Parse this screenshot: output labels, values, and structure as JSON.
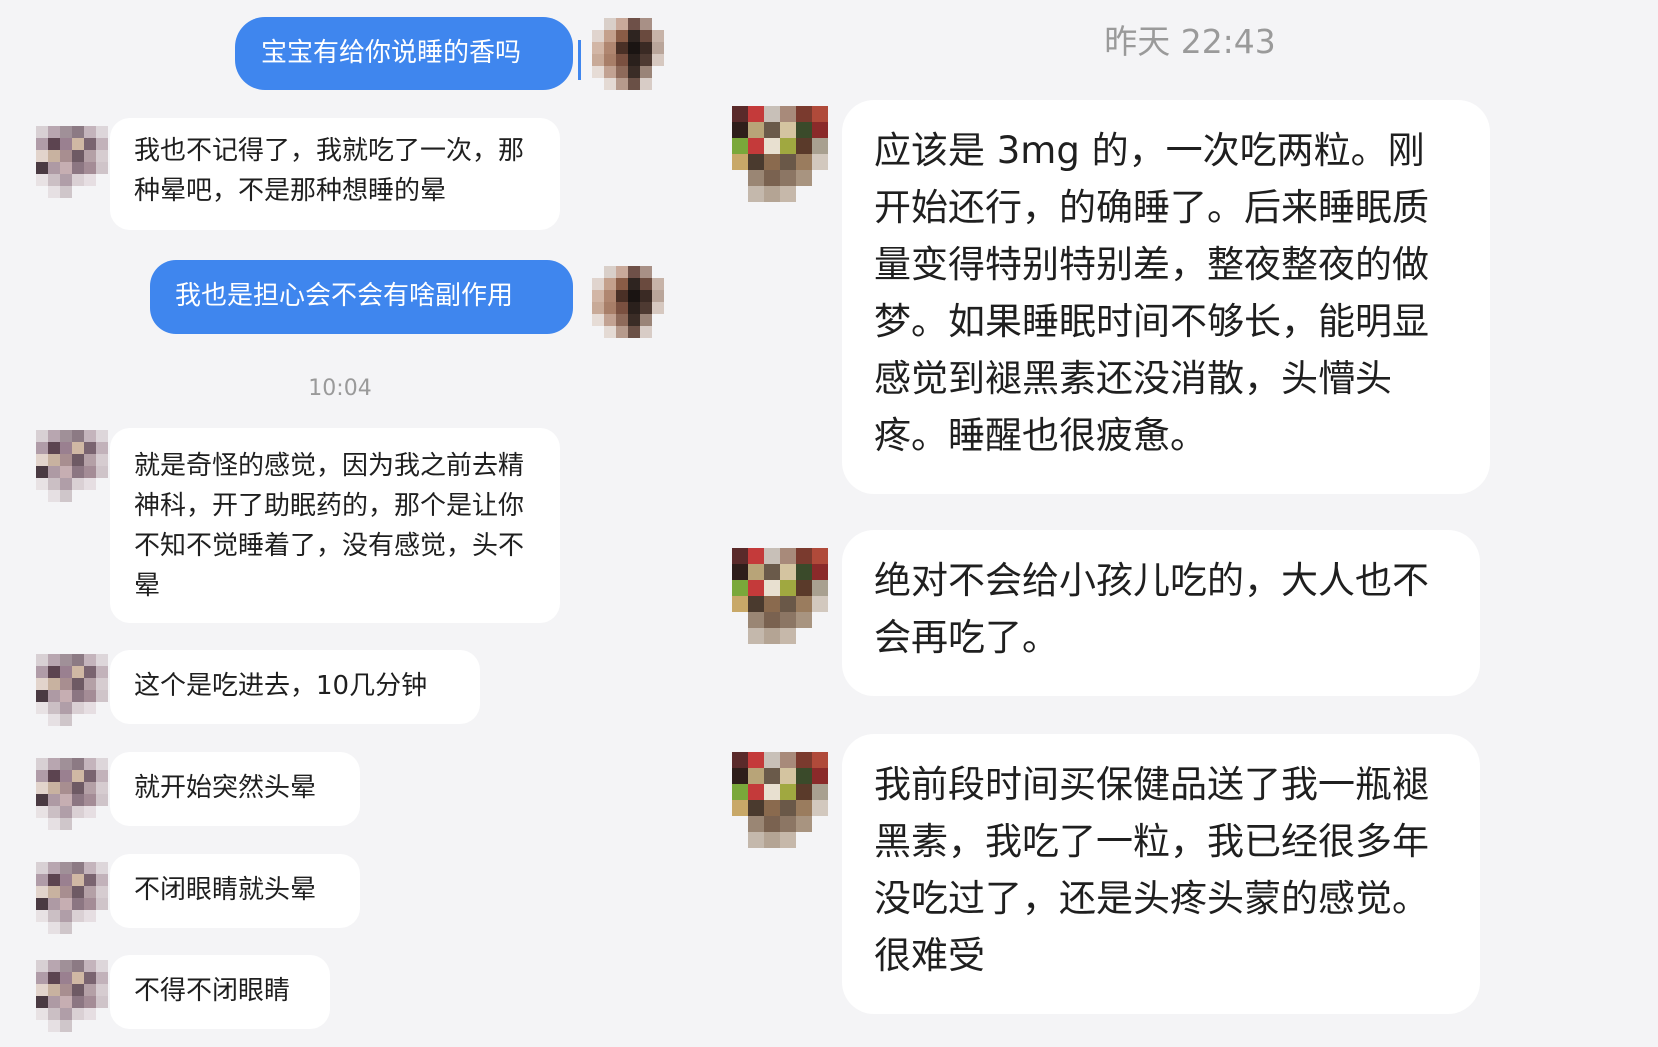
{
  "left": {
    "timestamp": "10:04",
    "messages": [
      {
        "side": "out",
        "text": "宝宝有给你说睡的香吗"
      },
      {
        "side": "in",
        "text": "我也不记得了，我就吃了一次，那种晕吧，不是那种想睡的晕"
      },
      {
        "side": "out",
        "text": "我也是担心会不会有啥副作用"
      },
      {
        "side": "in",
        "text": "就是奇怪的感觉，因为我之前去精神科，开了助眠药的，那个是让你不知不觉睡着了，没有感觉，头不晕"
      },
      {
        "side": "in",
        "text": "这个是吃进去，10几分钟"
      },
      {
        "side": "in",
        "text": "就开始突然头晕"
      },
      {
        "side": "in",
        "text": "不闭眼睛就头晕"
      },
      {
        "side": "in",
        "text": "不得不闭眼睛"
      }
    ]
  },
  "right": {
    "timestamp": "昨天 22:43",
    "messages": [
      {
        "side": "in",
        "text": "应该是 3mg 的，一次吃两粒。刚开始还行，的确睡了。后来睡眠质量变得特别特别差，整夜整夜的做梦。如果睡眠时间不够长，能明显感觉到褪黑素还没消散，头懵头疼。睡醒也很疲惫。"
      },
      {
        "side": "in",
        "text": "绝对不会给小孩儿吃的，大人也不会再吃了。"
      },
      {
        "side": "in",
        "text": "我前段时间买保健品送了我一瓶褪黑素，我吃了一粒，我已经很多年没吃过了，还是头疼头蒙的感觉。很难受"
      }
    ]
  },
  "colors": {
    "background": "#f4f4f6",
    "outgoing_bubble": "#3f86ee",
    "incoming_bubble": "#ffffff",
    "timestamp_text": "#9a9a9a"
  },
  "avatars": {
    "self": [
      "#f4f4f6",
      "#d9cfc9",
      "#c9a99a",
      "#6e5048",
      "#a89086",
      "#f4f4f6",
      "#e0d4ce",
      "#c4a08c",
      "#8a5c46",
      "#2e2420",
      "#6a4a3e",
      "#c7b3a8",
      "#d2b6a6",
      "#b08670",
      "#4a3026",
      "#1a1412",
      "#3a2a24",
      "#b9a59a",
      "#c8aa98",
      "#a87e68",
      "#7a5040",
      "#2a201c",
      "#4e3a32",
      "#d6c8c0",
      "#e6dcd6",
      "#c2a292",
      "#8e6a5a",
      "#3a2c26",
      "#9a8478",
      "#f4f4f6",
      "#f4f4f6",
      "#e4dad4",
      "#b69a8c",
      "#6a5046",
      "#d8ccc6",
      "#f4f4f6"
    ],
    "contact_left": [
      "#d8d0d4",
      "#b8a6b0",
      "#a09098",
      "#8c7a84",
      "#c4b4bc",
      "#ddd6da",
      "#b09ca8",
      "#5c4450",
      "#9a8090",
      "#d0b8a4",
      "#7a6470",
      "#c2b2ba",
      "#e2d4cc",
      "#c8b2a0",
      "#a88e90",
      "#6e5a64",
      "#b4a0a6",
      "#d6ccd0",
      "#4a3a42",
      "#ae9aa4",
      "#c6aeb2",
      "#8c7682",
      "#a48c96",
      "#cfc4c9",
      "#e8e2e4",
      "#cbbfc4",
      "#b09ea8",
      "#dad0d4",
      "#e6dee2",
      "#f4f4f6",
      "#f4f4f6",
      "#e6e0e3",
      "#cfc6ca",
      "#f4f4f6",
      "#f4f4f6",
      "#f4f4f6"
    ],
    "contact_right": [
      "#5a2a2a",
      "#c43a3a",
      "#c8c0b8",
      "#a88a7a",
      "#7a3a2e",
      "#b04a3a",
      "#2e1e1a",
      "#b8a478",
      "#6a5a4a",
      "#d4c4a0",
      "#3a4a2a",
      "#8a2a2a",
      "#7aa83a",
      "#c43a3a",
      "#e8e0d0",
      "#a0a840",
      "#5a3a2a",
      "#a8a090",
      "#c8a868",
      "#4a3a2e",
      "#8a6a4e",
      "#6a5848",
      "#9a7c5e",
      "#d2c8be",
      "#f4f4f6",
      "#9a8674",
      "#7a6250",
      "#8c7664",
      "#a89480",
      "#f4f4f6",
      "#f4f4f6",
      "#c4b8ac",
      "#b4a494",
      "#c6b8aa",
      "#f4f4f6",
      "#f4f4f6"
    ]
  }
}
